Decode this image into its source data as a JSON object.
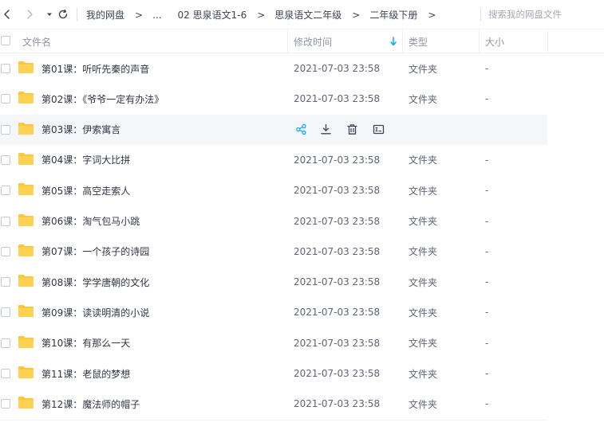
{
  "nav": {
    "back_icon": "chevron-left-icon",
    "forward_icon": "chevron-right-icon",
    "dropdown_icon": "caret-down-icon",
    "refresh_icon": "refresh-icon"
  },
  "breadcrumb": {
    "items": [
      "我的网盘",
      "...",
      "02 思泉语文1-6",
      "思泉语文二年级",
      "二年级下册"
    ],
    "separator": ">"
  },
  "search": {
    "placeholder": "搜索我的网盘文件",
    "value": ""
  },
  "table": {
    "columns": {
      "name": "文件名",
      "modified": "修改时间",
      "type": "类型",
      "size": "大小"
    },
    "sort_icon": "arrow-down-icon",
    "rows": [
      {
        "name": "第01课：听听先秦的声音",
        "modified": "2021-07-03 23:58",
        "type": "文件夹",
        "size": "-"
      },
      {
        "name": "第02课：《爷爷一定有办法》",
        "modified": "2021-07-03 23:58",
        "type": "文件夹",
        "size": "-"
      },
      {
        "name": "第03课：伊索寓言",
        "modified": "",
        "type": "",
        "size": ""
      },
      {
        "name": "第04课：字词大比拼",
        "modified": "2021-07-03 23:58",
        "type": "文件夹",
        "size": "-"
      },
      {
        "name": "第05课：高空走索人",
        "modified": "2021-07-03 23:58",
        "type": "文件夹",
        "size": "-"
      },
      {
        "name": "第06课：淘气包马小跳",
        "modified": "2021-07-03 23:58",
        "type": "文件夹",
        "size": "-"
      },
      {
        "name": "第07课：一个孩子的诗园",
        "modified": "2021-07-03 23:58",
        "type": "文件夹",
        "size": "-"
      },
      {
        "name": "第08课：学学唐朝的文化",
        "modified": "2021-07-03 23:58",
        "type": "文件夹",
        "size": "-"
      },
      {
        "name": "第09课：读读明清的小说",
        "modified": "2021-07-03 23:58",
        "type": "文件夹",
        "size": "-"
      },
      {
        "name": "第10课：有那么一天",
        "modified": "2021-07-03 23:58",
        "type": "文件夹",
        "size": "-"
      },
      {
        "name": "第11课：老鼠的梦想",
        "modified": "2021-07-03 23:58",
        "type": "文件夹",
        "size": "-"
      },
      {
        "name": "第12课：魔法师的帽子",
        "modified": "2021-07-03 23:58",
        "type": "文件夹",
        "size": "-"
      }
    ],
    "hover_actions": [
      "share-icon",
      "download-icon",
      "delete-icon",
      "rename-icon"
    ]
  },
  "colors": {
    "folder": "#ffc637",
    "accent": "#06a7ff",
    "hover_row": "#f5f6fa"
  }
}
